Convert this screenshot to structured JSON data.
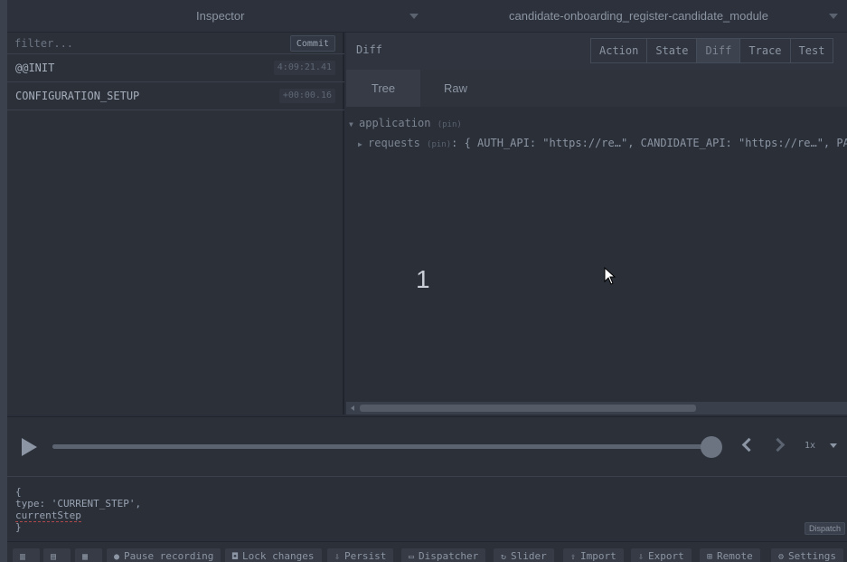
{
  "topbar": {
    "instance_label": "Inspector",
    "store_label": "candidate-onboarding_register-candidate_module"
  },
  "actions": {
    "filter_placeholder": "filter...",
    "commit_label": "Commit",
    "items": [
      {
        "name": "@@INIT",
        "time": "4:09:21.41"
      },
      {
        "name": "CONFIGURATION_SETUP",
        "time": "+00:00.16"
      }
    ]
  },
  "monitor": {
    "title": "Diff",
    "tabs": [
      "Action",
      "State",
      "Diff",
      "Trace",
      "Test"
    ],
    "active_tab": "Diff",
    "subtabs": [
      "Tree",
      "Raw"
    ],
    "active_subtab": "Tree",
    "tree": {
      "root_key": "application",
      "root_pin": "(pin)",
      "child_key": "requests",
      "child_pin": "(pin)",
      "child_value": ": { AUTH_API: \"https://re…\", CANDIDATE_API: \"https://re…\", PA"
    }
  },
  "overlay": {
    "number": "1"
  },
  "player": {
    "speed": "1x",
    "progress": 1.0
  },
  "dispatcher": {
    "line1": "{",
    "line2": "type: 'CURRENT_STEP',",
    "line3": "currentStep",
    "line4": "}",
    "dispatch_label": "Dispatch"
  },
  "toolbar": {
    "pause_label": "Pause recording",
    "lock_label": "Lock changes",
    "persist_label": "Persist",
    "dispatcher_label": "Dispatcher",
    "slider_label": "Slider",
    "import_label": "Import",
    "export_label": "Export",
    "remote_label": "Remote",
    "settings_label": "Settings"
  },
  "colors": {
    "background": "#2a2f3a",
    "text": "#9aa3b2",
    "active_tab": "#3c424e"
  }
}
